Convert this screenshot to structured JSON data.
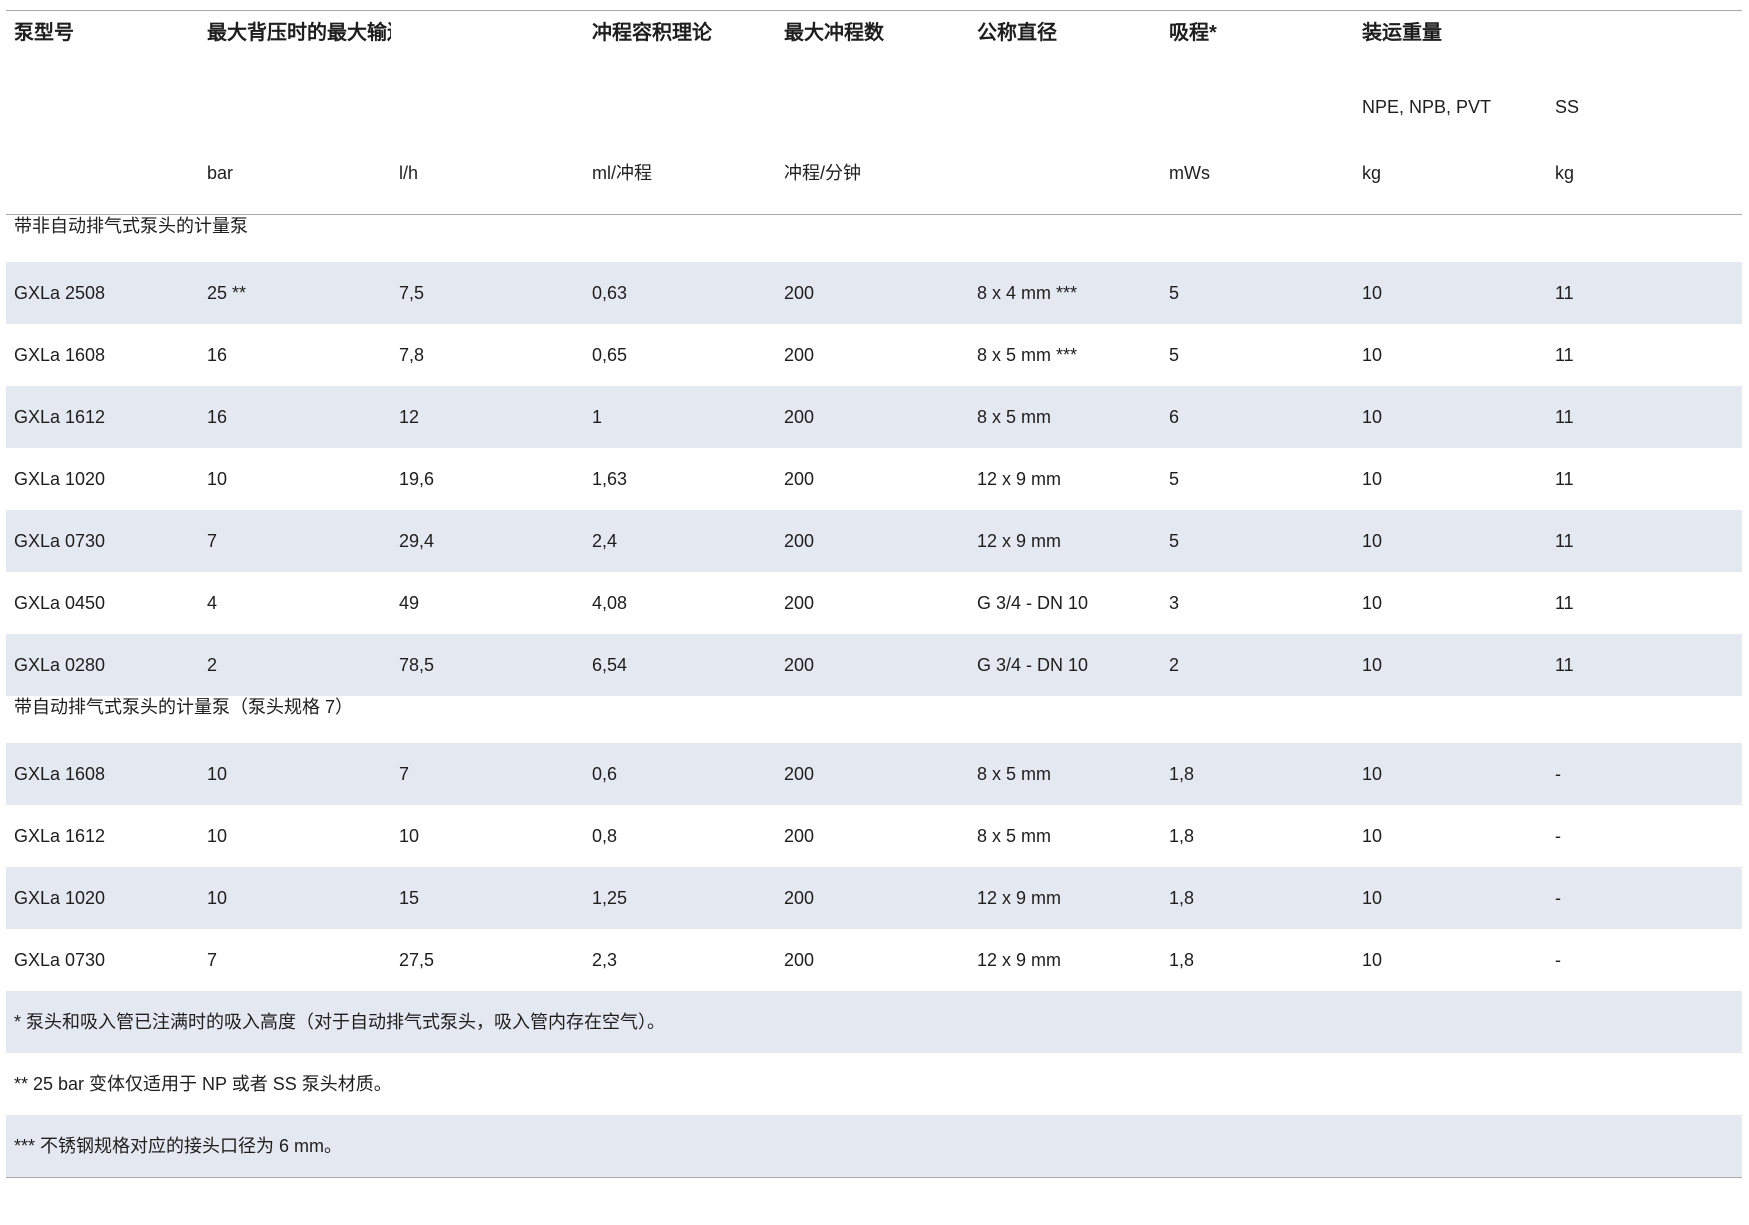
{
  "header": {
    "row1": [
      "泵型号",
      "最大背压时的最大输送流量",
      "",
      "冲程容积理论",
      "最大冲程数",
      "公称直径",
      "吸程*",
      "装运重量",
      ""
    ],
    "row2": [
      "",
      "",
      "",
      "",
      "",
      "",
      "",
      "NPE, NPB, PVT",
      "SS"
    ],
    "row3": [
      "",
      "bar",
      "l/h",
      "ml/冲程",
      "冲程/分钟",
      "",
      "mWs",
      "kg",
      "kg"
    ]
  },
  "sections": [
    {
      "title": "带非自动排气式泵头的计量泵",
      "rows": [
        [
          "GXLa 2508",
          "25 **",
          "7,5",
          "0,63",
          "200",
          "8 x 4 mm ***",
          "5",
          "10",
          "11"
        ],
        [
          "GXLa 1608",
          "16",
          "7,8",
          "0,65",
          "200",
          "8 x 5 mm ***",
          "5",
          "10",
          "11"
        ],
        [
          "GXLa 1612",
          "16",
          "12",
          "1",
          "200",
          "8 x 5 mm",
          "6",
          "10",
          "11"
        ],
        [
          "GXLa 1020",
          "10",
          "19,6",
          "1,63",
          "200",
          "12 x 9 mm",
          "5",
          "10",
          "11"
        ],
        [
          "GXLa 0730",
          "7",
          "29,4",
          "2,4",
          "200",
          "12 x 9 mm",
          "5",
          "10",
          "11"
        ],
        [
          "GXLa 0450",
          "4",
          "49",
          "4,08",
          "200",
          "G 3/4 - DN 10",
          "3",
          "10",
          "11"
        ],
        [
          "GXLa 0280",
          "2",
          "78,5",
          "6,54",
          "200",
          "G 3/4 - DN 10",
          "2",
          "10",
          "11"
        ]
      ]
    },
    {
      "title": "带自动排气式泵头的计量泵（泵头规格 7）",
      "rows": [
        [
          "GXLa 1608",
          "10",
          "7",
          "0,6",
          "200",
          "8 x 5 mm",
          "1,8",
          "10",
          "-"
        ],
        [
          "GXLa 1612",
          "10",
          "10",
          "0,8",
          "200",
          "8 x 5 mm",
          "1,8",
          "10",
          "-"
        ],
        [
          "GXLa 1020",
          "10",
          "15",
          "1,25",
          "200",
          "12 x 9 mm",
          "1,8",
          "10",
          "-"
        ],
        [
          "GXLa 0730",
          "7",
          "27,5",
          "2,3",
          "200",
          "12 x 9 mm",
          "1,8",
          "10",
          "-"
        ]
      ]
    }
  ],
  "notes": [
    "* 泵头和吸入管已注满时的吸入高度（对于自动排气式泵头，吸入管内存在空气）。",
    "** 25 bar 变体仅适用于 NP 或者 SS 泵头材质。",
    "*** 不锈钢规格对应的接头口径为 6 mm。"
  ],
  "colors": {
    "stripe": "#e4e8f1",
    "rule": "#a9a9a9",
    "text": "#1e1e1e"
  }
}
